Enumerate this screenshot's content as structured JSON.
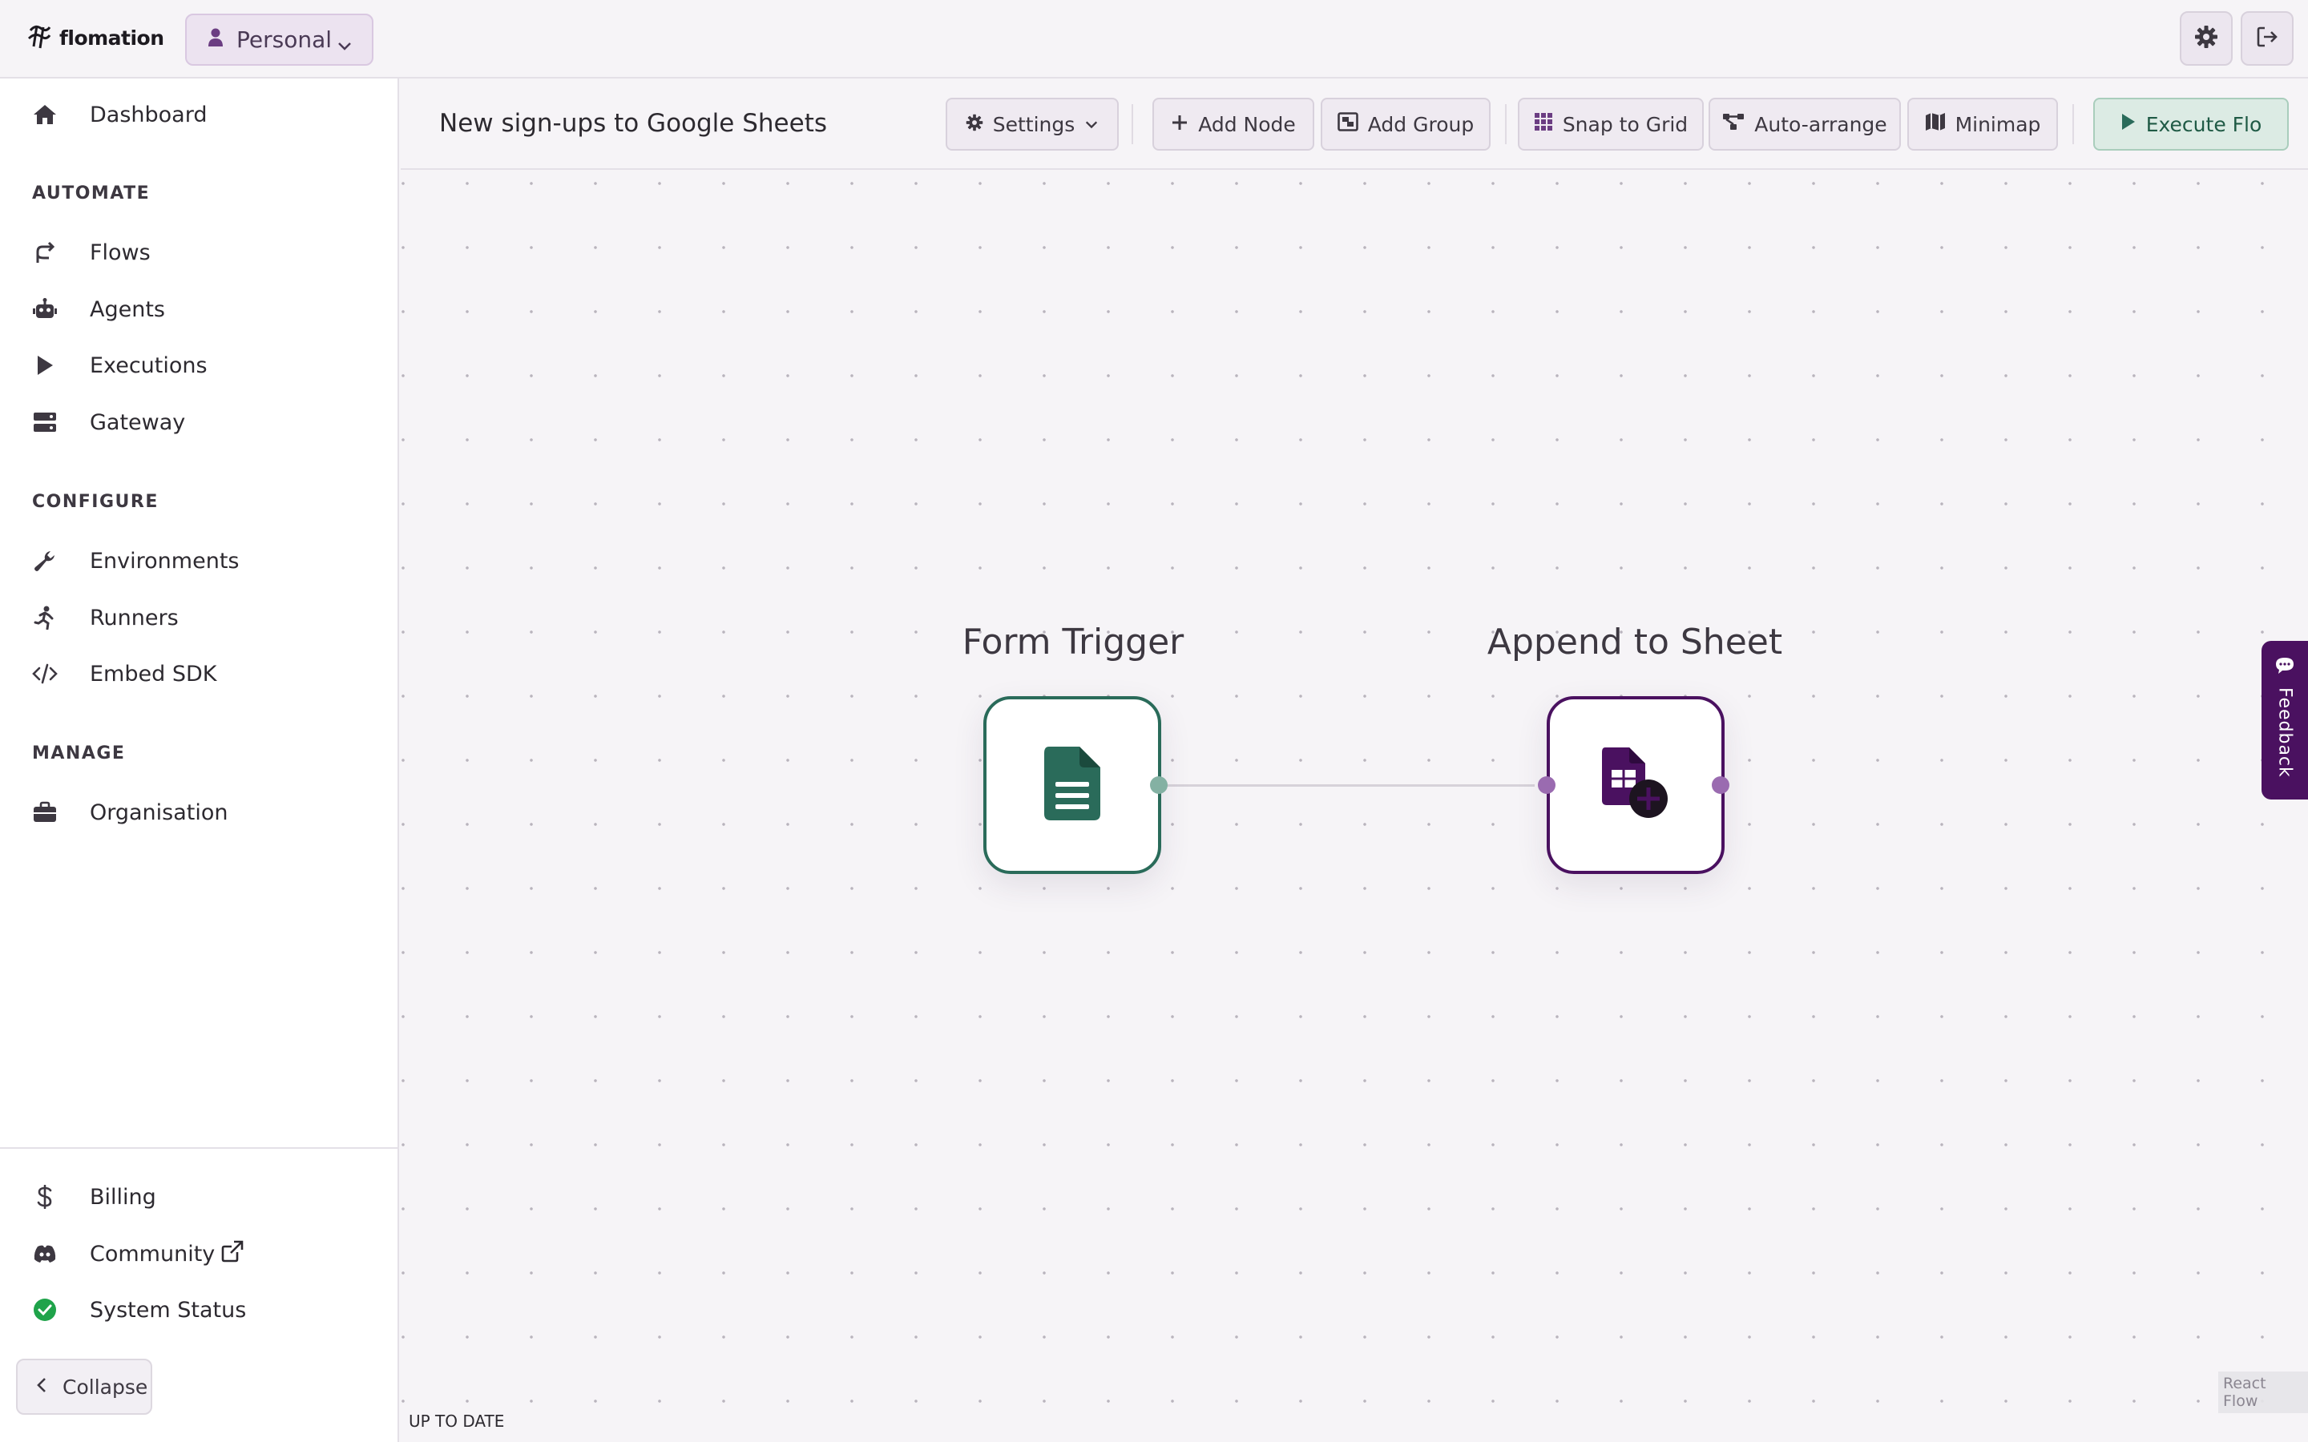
{
  "app": {
    "name": "flomation"
  },
  "workspace": {
    "label": "Personal"
  },
  "sidebar": {
    "dashboard": "Dashboard",
    "sections": {
      "automate": "AUTOMATE",
      "configure": "CONFIGURE",
      "manage": "MANAGE"
    },
    "automate_items": [
      "Flows",
      "Agents",
      "Executions",
      "Gateway"
    ],
    "configure_items": [
      "Environments",
      "Runners",
      "Embed SDK"
    ],
    "manage_items": [
      "Organisation"
    ],
    "bottom_items": [
      "Billing",
      "Community",
      "System Status"
    ],
    "collapse": "Collapse"
  },
  "toolbar": {
    "title": "New sign-ups to Google Sheets",
    "settings": "Settings",
    "add_node": "Add Node",
    "add_group": "Add Group",
    "snap_to_grid": "Snap to Grid",
    "auto_arrange": "Auto-arrange",
    "minimap": "Minimap",
    "execute": "Execute Flo"
  },
  "nodes": [
    {
      "label": "Form Trigger",
      "color": "#2a6b5a"
    },
    {
      "label": "Append to Sheet",
      "color": "#4a1160"
    }
  ],
  "feedback": "Feedback",
  "attribution": "React Flow",
  "status": "UP TO DATE",
  "colors": {
    "accent_purple": "#4a1160",
    "accent_green": "#2a6b5a",
    "status_ok": "#1fa34a"
  }
}
